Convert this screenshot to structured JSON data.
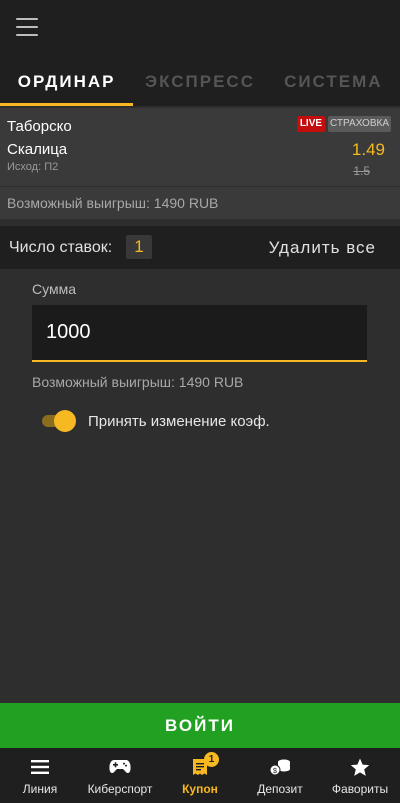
{
  "tabs": [
    {
      "label": "ОРДИНАР",
      "active": true
    },
    {
      "label": "ЭКСПРЕСС",
      "active": false
    },
    {
      "label": "СИСТЕМА",
      "active": false
    }
  ],
  "bet": {
    "team1": "Таборско",
    "team2": "Скалица",
    "outcome": "Исход: П2",
    "live_badge": "LIVE",
    "insurance_badge": "СТРАХОВКА",
    "coefficient": "1.49",
    "old_coefficient": "1.5",
    "possible_win": "Возможный выигрыш: 1490 RUB"
  },
  "controls": {
    "bets_count_label": "Число ставок:",
    "bets_count_value": "1",
    "delete_all_label": "Удалить все"
  },
  "sum": {
    "label": "Сумма",
    "value": "1000",
    "possible_win": "Возможный выигрыш: 1490 RUB"
  },
  "accept_changes": {
    "label": "Принять изменение коэф.",
    "enabled": true
  },
  "login_button": "ВОЙТИ",
  "bottom_nav": [
    {
      "label": "Линия",
      "icon": "list-icon",
      "active": false
    },
    {
      "label": "Киберспорт",
      "icon": "gamepad-icon",
      "active": false
    },
    {
      "label": "Купон",
      "icon": "coupon-icon",
      "active": true,
      "badge": "1"
    },
    {
      "label": "Депозит",
      "icon": "coins-icon",
      "active": false
    },
    {
      "label": "Фавориты",
      "icon": "star-icon",
      "active": false
    }
  ],
  "colors": {
    "accent": "#f6b922",
    "login_green": "#21a021",
    "live_red": "#c40d0d"
  }
}
